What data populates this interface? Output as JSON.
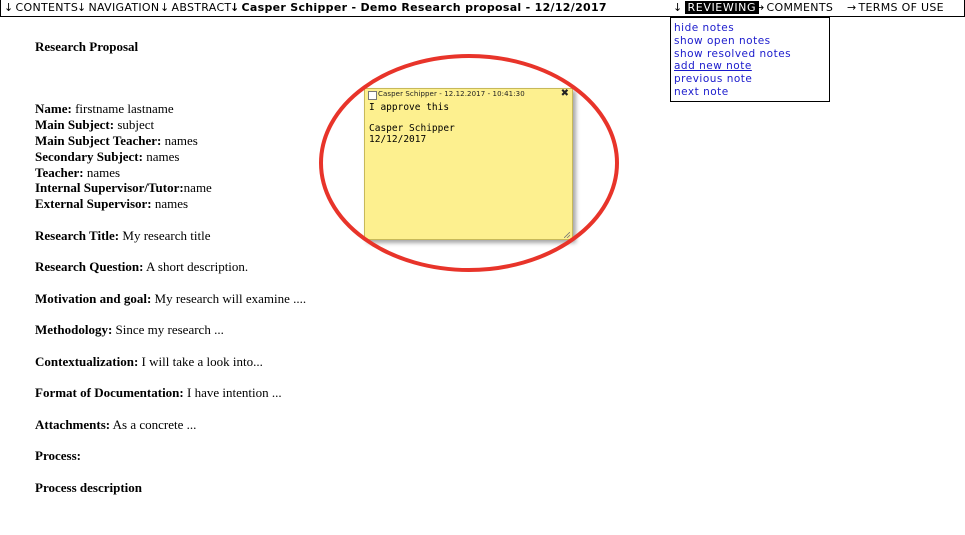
{
  "topbar": {
    "contents": "CONTENTS",
    "navigation": "NAVIGATION",
    "abstract": "ABSTRACT",
    "document_title": "Casper Schipper - Demo Research proposal - 12/12/2017",
    "reviewing": "REVIEWING",
    "comments": "COMMENTS",
    "terms": "TERMS OF USE",
    "arrow_down": "↓",
    "arrow_right": "→"
  },
  "reviewing_menu": {
    "items": [
      "hide notes",
      "show open notes",
      "show resolved notes",
      "add new note",
      "previous note",
      "next note"
    ]
  },
  "document": {
    "heading": "Research Proposal",
    "fields": [
      {
        "label": "Name:",
        "value": " firstname lastname"
      },
      {
        "label": "Main Subject:",
        "value": " subject"
      },
      {
        "label": "Main Subject Teacher:",
        "value": " names"
      },
      {
        "label": "Secondary Subject:",
        "value": " names"
      },
      {
        "label": "Teacher:",
        "value": " names"
      },
      {
        "label": "Internal Supervisor/Tutor:",
        "value": "name"
      },
      {
        "label": "External Supervisor:",
        "value": " names"
      },
      {
        "label": "Research Title:",
        "value": " My research title"
      },
      {
        "label": "Research Question:",
        "value": " A short description."
      },
      {
        "label": "Motivation and goal:",
        "value": " My research will examine ...."
      },
      {
        "label": "Methodology:",
        "value": " Since my research ..."
      },
      {
        "label": "Contextualization:",
        "value": " I will take a look into..."
      },
      {
        "label": "Format of Documentation:",
        "value": " I have intention ..."
      },
      {
        "label": "Attachments:",
        "value": " As a concrete ..."
      },
      {
        "label": "Process:",
        "value": ""
      },
      {
        "label": "Process description",
        "value": ""
      }
    ]
  },
  "note": {
    "author_line": "Casper Schipper - 12.12.2017 - 10:41:30",
    "close": "✖",
    "body": "I approve this\n\nCasper Schipper\n12/12/2017"
  },
  "colors": {
    "note_bg": "#fdf08f",
    "highlight_ring": "#e8342a",
    "link": "#1a1acc"
  }
}
